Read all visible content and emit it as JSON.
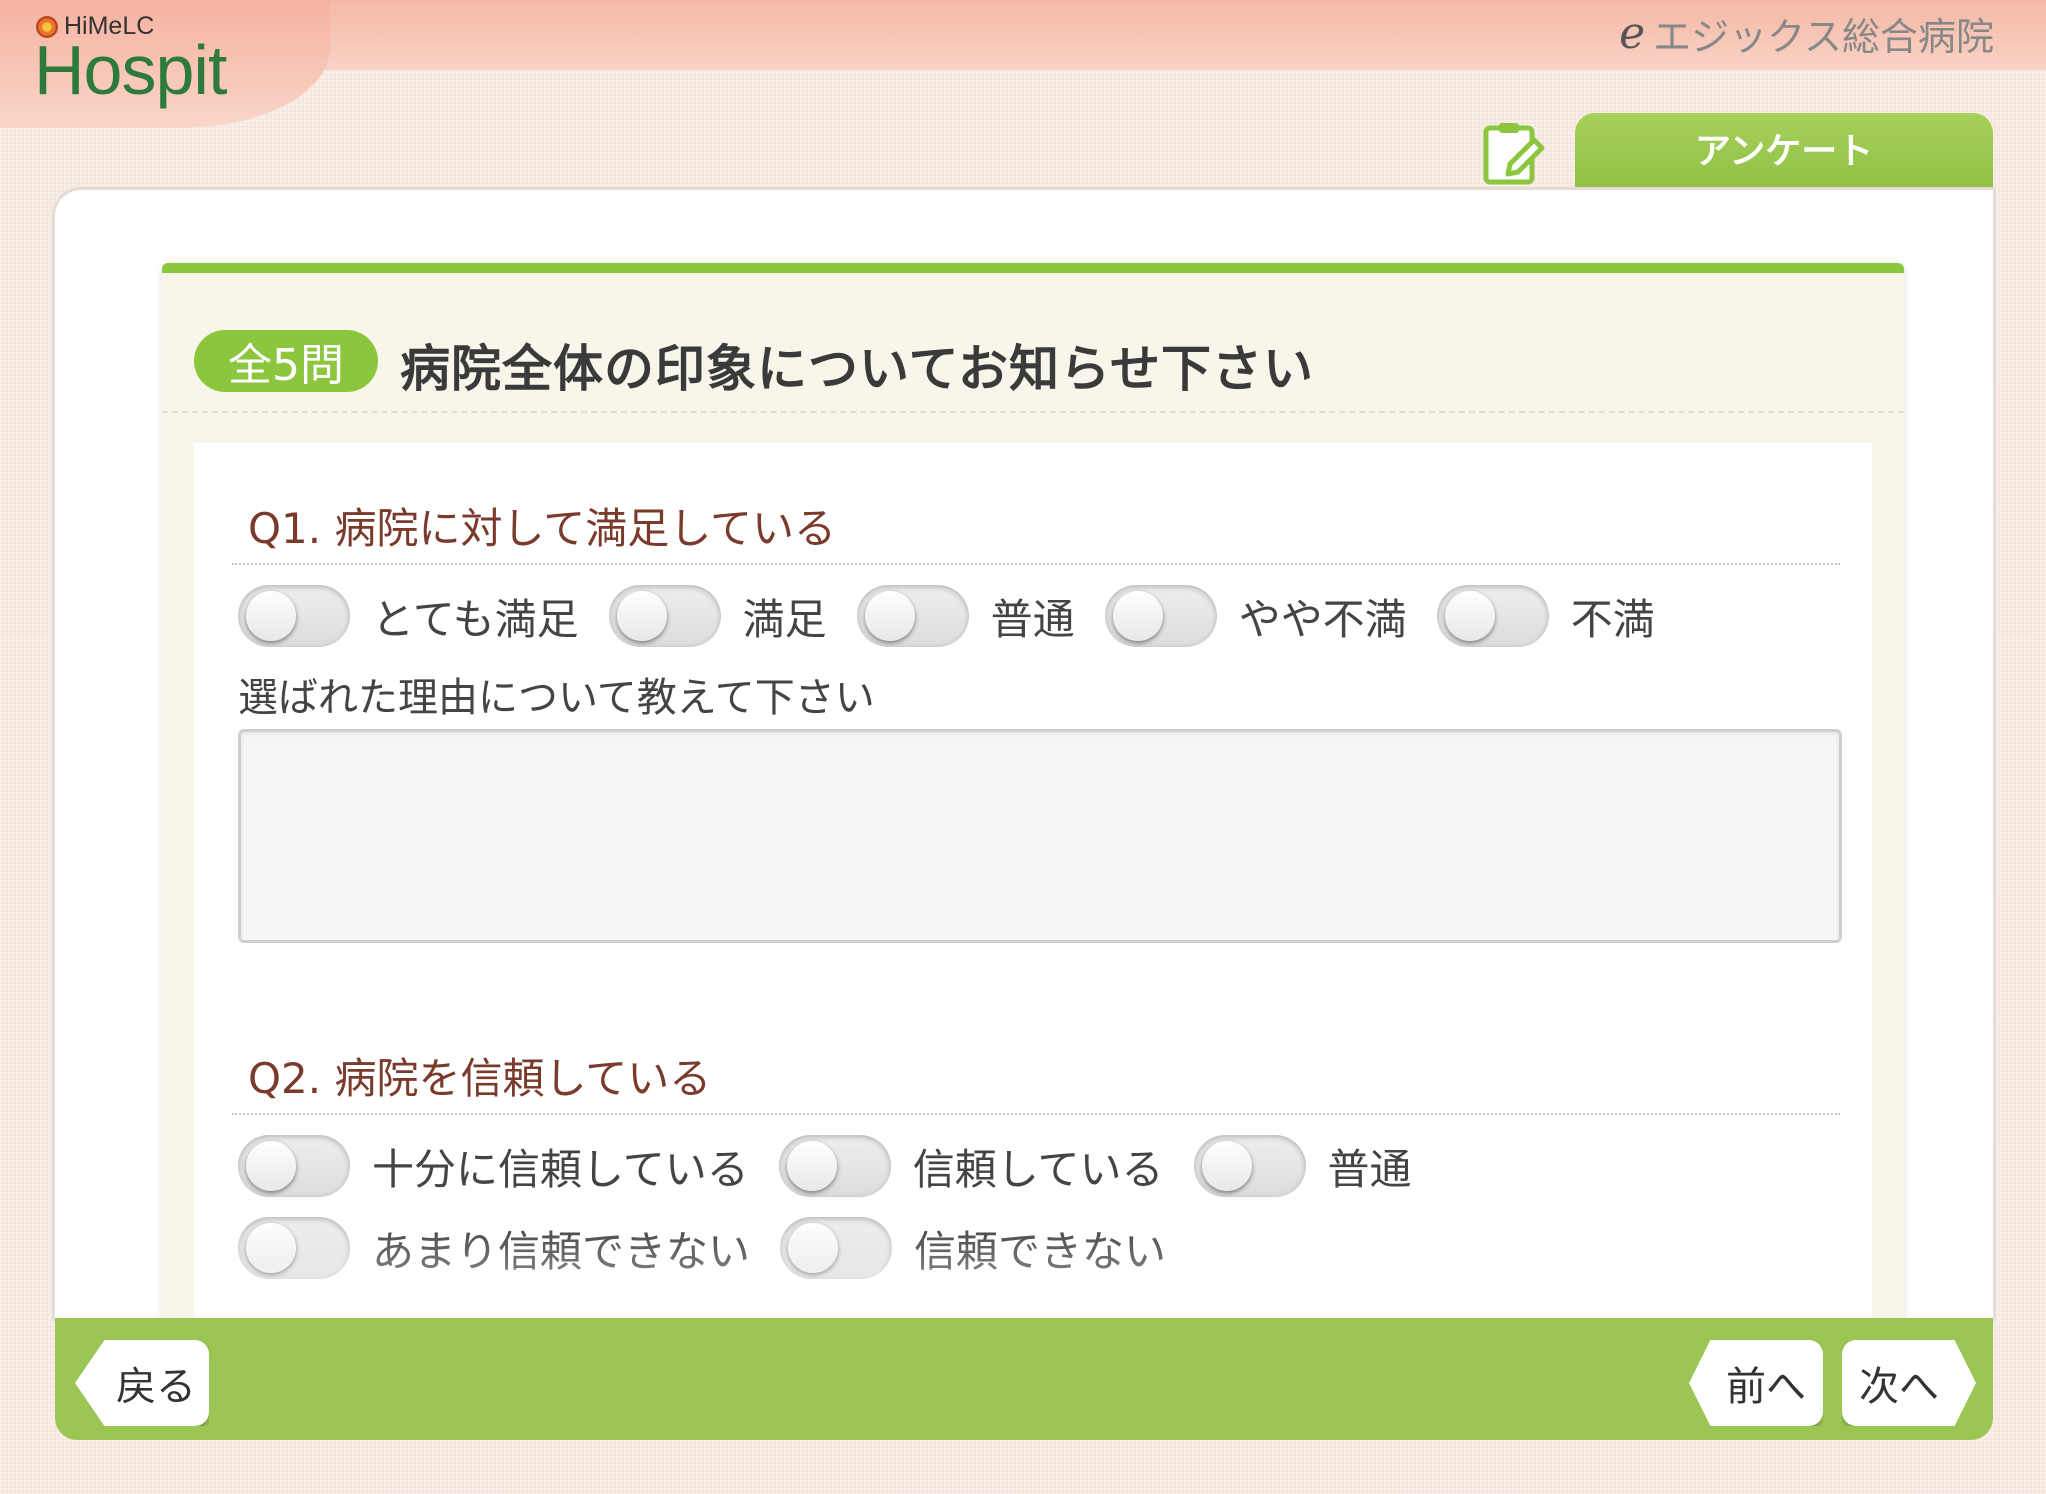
{
  "app": {
    "logo_small": "HiMeLC",
    "logo_big": "Hospit",
    "hospital_name": "エジックス総合病院",
    "hospital_icon": "e-logo-icon"
  },
  "tab": {
    "label": "アンケート",
    "icon": "clipboard-edit-icon"
  },
  "survey": {
    "count_badge": "全5問",
    "title": "病院全体の印象についてお知らせ下さい",
    "questions": [
      {
        "title": "Q1. 病院に対して満足している",
        "options": [
          "とても満足",
          "満足",
          "普通",
          "やや不満",
          "不満"
        ],
        "reason_label": "選ばれた理由について教えて下さい",
        "reason_value": ""
      },
      {
        "title": "Q2. 病院を信頼している",
        "options": [
          "十分に信頼している",
          "信頼している",
          "普通",
          "あまり信頼できない",
          "信頼できない"
        ]
      }
    ]
  },
  "footer": {
    "back_label": "戻る",
    "prev_label": "前へ",
    "next_label": "次へ"
  },
  "colors": {
    "accent_green": "#8cc63f",
    "footer_green": "#9cc653",
    "header_salmon": "#f6b8a6",
    "question_brown": "#7b3b2c"
  }
}
